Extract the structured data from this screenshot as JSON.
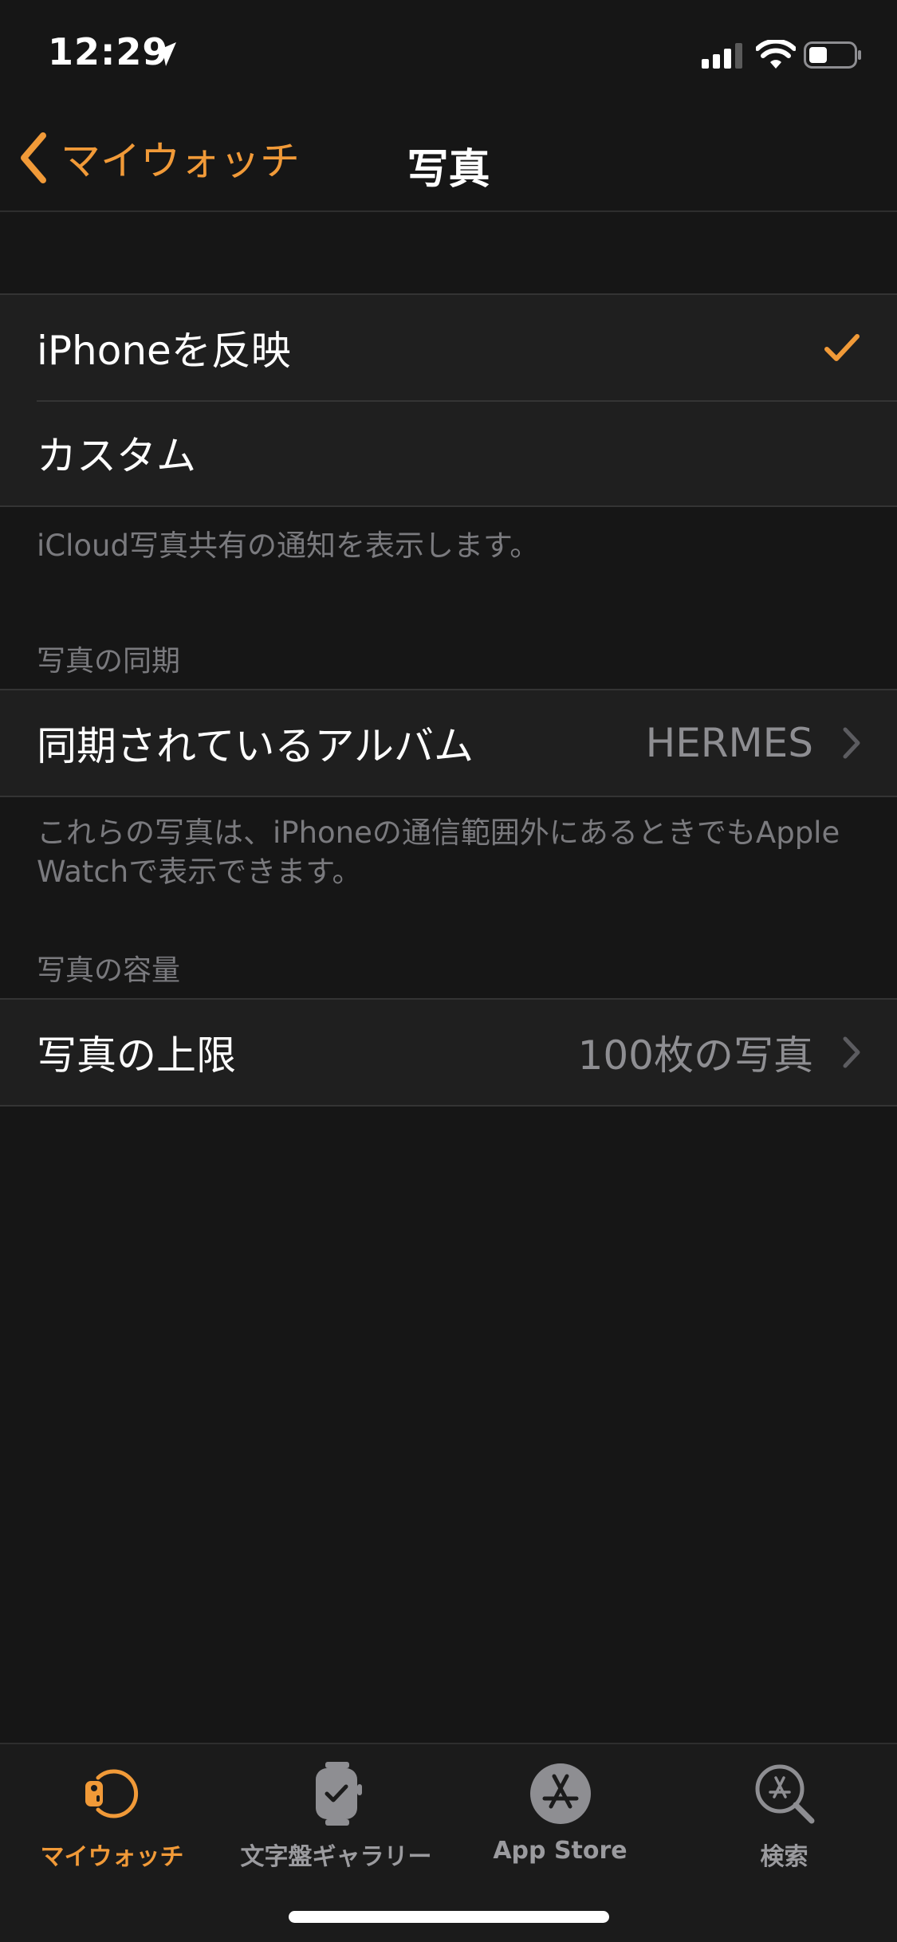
{
  "status_bar": {
    "time": "12:29"
  },
  "nav": {
    "back_label": "マイウォッチ",
    "title": "写真"
  },
  "photo_source": {
    "options": [
      {
        "label": "iPhoneを反映",
        "selected": true
      },
      {
        "label": "カスタム",
        "selected": false
      }
    ],
    "footer": "iCloud写真共有の通知を表示します。"
  },
  "sync": {
    "header": "写真の同期",
    "album_label": "同期されているアルバム",
    "album_value": "HERMES",
    "footer": "これらの写真は、iPhoneの通信範囲外にあるときでもApple Watchで表示できます。"
  },
  "capacity": {
    "header": "写真の容量",
    "limit_label": "写真の上限",
    "limit_value": "100枚の写真"
  },
  "tab_bar": {
    "tabs": [
      {
        "label": "マイウォッチ",
        "icon": "my-watch-icon",
        "active": true
      },
      {
        "label": "文字盤ギャラリー",
        "icon": "face-gallery-icon",
        "active": false
      },
      {
        "label": "App Store",
        "icon": "app-store-icon",
        "active": false
      },
      {
        "label": "検索",
        "icon": "search-icon",
        "active": false
      }
    ]
  },
  "colors": {
    "accent": "#f19a38",
    "background": "#161616",
    "cell": "#1f1f1f",
    "secondary_text": "#8e8e92"
  }
}
